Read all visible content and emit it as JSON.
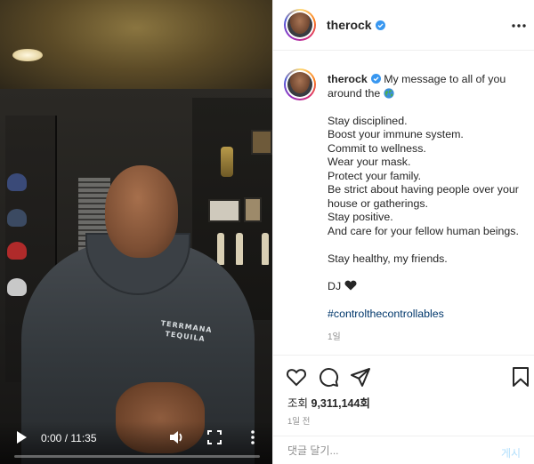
{
  "video": {
    "current_time": "0:00",
    "duration": "11:35",
    "time_display": "0:00 / 11:35",
    "progress_fraction": 0.0,
    "shirt_text_line1": "TERRMANA",
    "shirt_text_line2": "TEQUILA"
  },
  "header": {
    "username": "therock",
    "verified": true,
    "more_icon": "more-horizontal-icon"
  },
  "caption": {
    "username": "therock",
    "intro": "My message to all of you",
    "intro_cont": "around the",
    "globe_icon": "globe-emoji",
    "lines": [
      "Stay disciplined.",
      "Boost your immune system.",
      "Commit to wellness.",
      "Wear your mask.",
      "Protect your family."
    ],
    "strict_line": "Be strict about having people over your house or gatherings.",
    "lines2": [
      "Stay positive.",
      "And care for your fellow human beings."
    ],
    "closing": "Stay healthy, my friends.",
    "signature": "DJ",
    "heart_icon": "black-heart-emoji",
    "hashtag": "#controlthecontrollables",
    "time_ago": "1일"
  },
  "actions": {
    "views_label": "조회",
    "views_count": "9,311,144회",
    "posted": "1일 전"
  },
  "comment": {
    "placeholder": "댓글 달기...",
    "post_label": "게시"
  },
  "colors": {
    "link": "#00376b",
    "verified": "#3897f0",
    "muted": "#8e8e8e",
    "post_disabled": "#b2dffc"
  }
}
